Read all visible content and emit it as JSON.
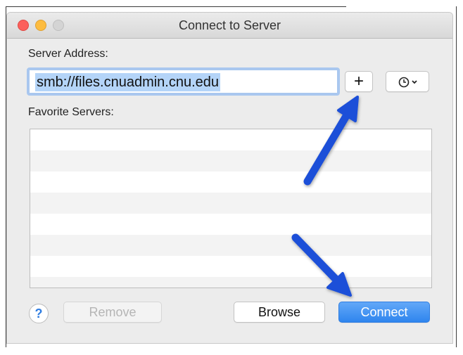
{
  "window": {
    "title": "Connect to Server"
  },
  "server_address": {
    "label": "Server Address:",
    "value": "smb://files.cnuadmin.cnu.edu"
  },
  "buttons": {
    "add_symbol": "+",
    "remove_label": "Remove",
    "browse_label": "Browse",
    "connect_label": "Connect",
    "help_symbol": "?"
  },
  "favorites": {
    "label": "Favorite Servers:",
    "rows": 7
  },
  "icons": {
    "recent_servers": "clock-icon",
    "dropdown": "chevron-down-icon",
    "annotation": "arrow-icon"
  },
  "colors": {
    "accent": "#3b8ff0",
    "annotation_arrow": "#1f4fd8",
    "close": "#fc605c",
    "minimize": "#fdbc40"
  }
}
